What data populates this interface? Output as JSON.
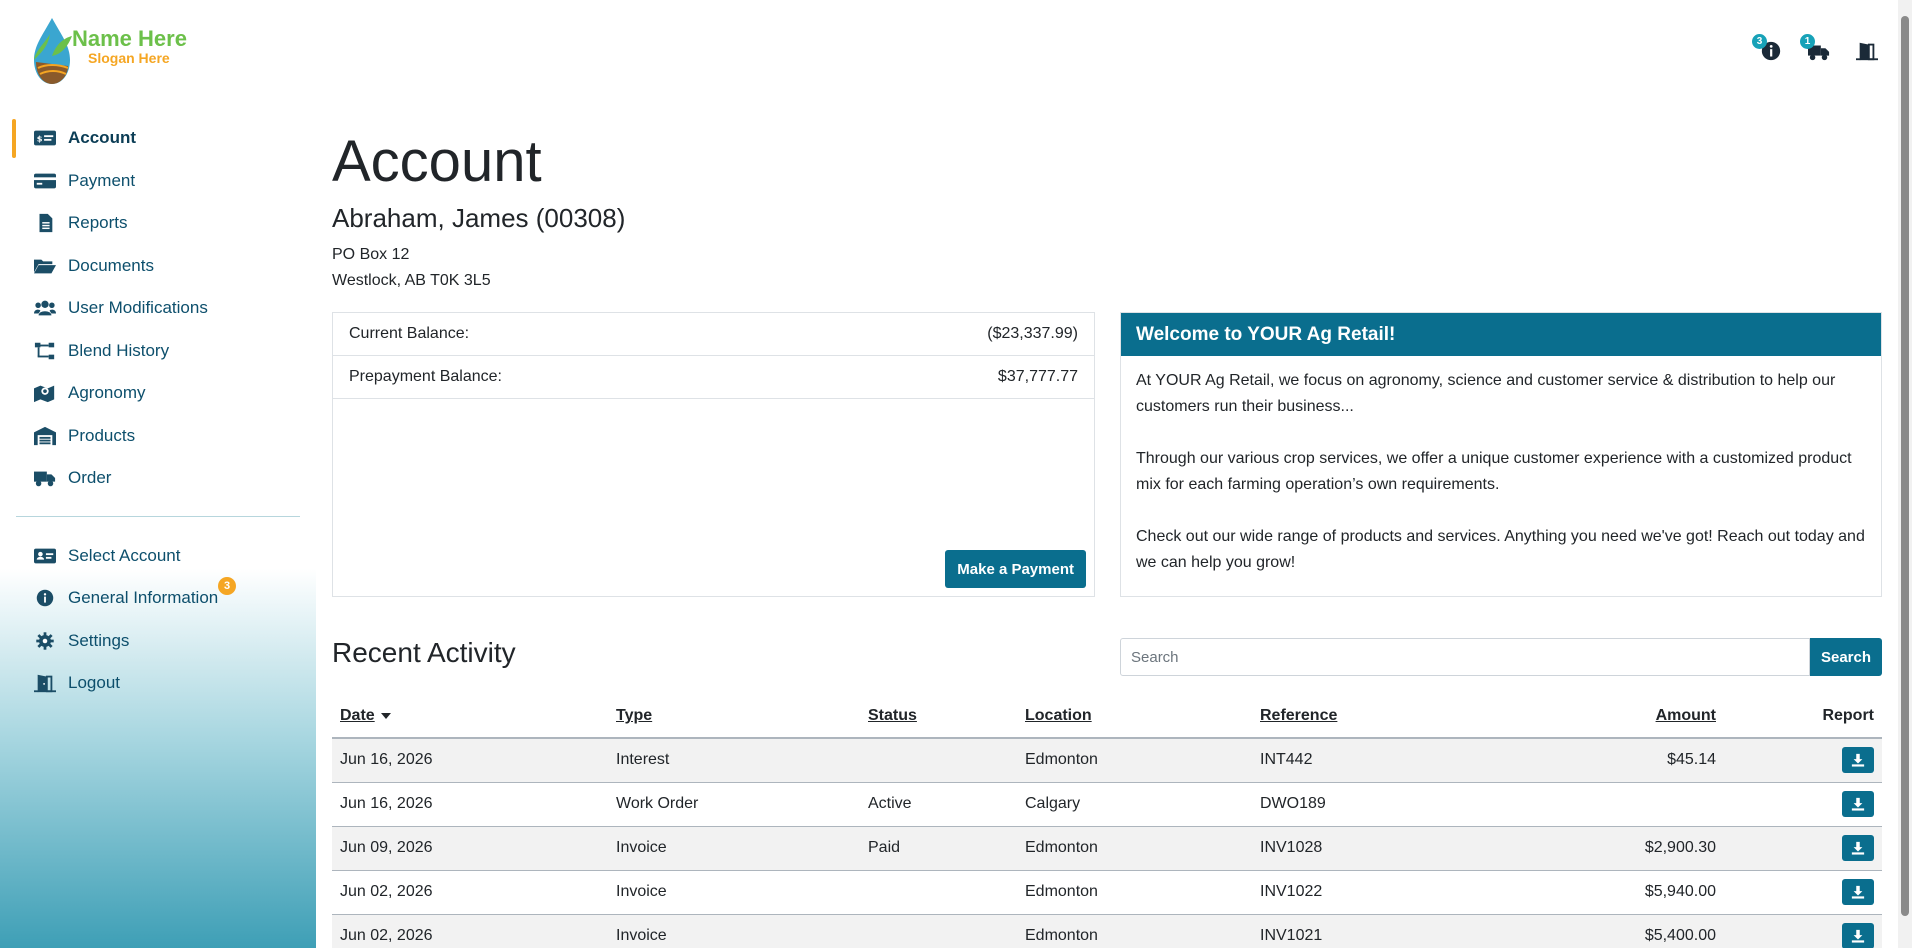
{
  "brand": {
    "name": "Name Here",
    "slogan": "Slogan Here"
  },
  "header": {
    "info_badge": "3",
    "order_badge": "1"
  },
  "sidebar": {
    "items": [
      {
        "label": "Account",
        "icon": "money-check-icon"
      },
      {
        "label": "Payment",
        "icon": "credit-card-icon"
      },
      {
        "label": "Reports",
        "icon": "file-icon"
      },
      {
        "label": "Documents",
        "icon": "folder-open-icon"
      },
      {
        "label": "User Modifications",
        "icon": "users-icon"
      },
      {
        "label": "Blend History",
        "icon": "sitemap-icon"
      },
      {
        "label": "Agronomy",
        "icon": "map-marker-icon"
      },
      {
        "label": "Products",
        "icon": "warehouse-icon"
      },
      {
        "label": "Order",
        "icon": "truck-icon"
      }
    ],
    "secondary": [
      {
        "label": "Select Account",
        "icon": "id-card-icon"
      },
      {
        "label": "General Information",
        "icon": "info-circle-icon",
        "badge": "3"
      },
      {
        "label": "Settings",
        "icon": "gear-icon"
      },
      {
        "label": "Logout",
        "icon": "door-open-icon"
      }
    ]
  },
  "page": {
    "title": "Account",
    "account_name": "Abraham, James (00308)",
    "address_line1": "PO Box 12",
    "address_line2": "Westlock, AB T0K 3L5"
  },
  "balances": {
    "current_label": "Current Balance:",
    "current_value": "($23,337.99)",
    "prepay_label": "Prepayment Balance:",
    "prepay_value": "$37,777.77",
    "pay_button": "Make a Payment"
  },
  "welcome": {
    "title": "Welcome to YOUR Ag Retail!",
    "p1": "At YOUR Ag Retail, we focus on agronomy, science and customer service & distribution to help our customers run their business...",
    "p2": "Through our various crop services, we offer a unique customer experience with a customized product mix for each farming operation’s own requirements.",
    "p3": "Check out our wide range of products and services. Anything you need we've got! Reach out today and we can help you grow!"
  },
  "activity": {
    "title": "Recent Activity",
    "search_placeholder": "Search",
    "search_button": "Search",
    "columns": {
      "date": "Date",
      "type": "Type",
      "status": "Status",
      "location": "Location",
      "reference": "Reference",
      "amount": "Amount",
      "report": "Report"
    },
    "rows": [
      {
        "date": "Jun 16, 2026",
        "type": "Interest",
        "status": "",
        "location": "Edmonton",
        "reference": "INT442",
        "amount": "$45.14"
      },
      {
        "date": "Jun 16, 2026",
        "type": "Work Order",
        "status": "Active",
        "location": "Calgary",
        "reference": "DWO189",
        "amount": ""
      },
      {
        "date": "Jun 09, 2026",
        "type": "Invoice",
        "status": "Paid",
        "location": "Edmonton",
        "reference": "INV1028",
        "amount": "$2,900.30"
      },
      {
        "date": "Jun 02, 2026",
        "type": "Invoice",
        "status": "",
        "location": "Edmonton",
        "reference": "INV1022",
        "amount": "$5,940.00"
      },
      {
        "date": "Jun 02, 2026",
        "type": "Invoice",
        "status": "",
        "location": "Edmonton",
        "reference": "INV1021",
        "amount": "$5,400.00"
      }
    ]
  },
  "colors": {
    "primary": "#0a6e8e",
    "accent": "#f5a623",
    "logo_green": "#6cc04a"
  }
}
